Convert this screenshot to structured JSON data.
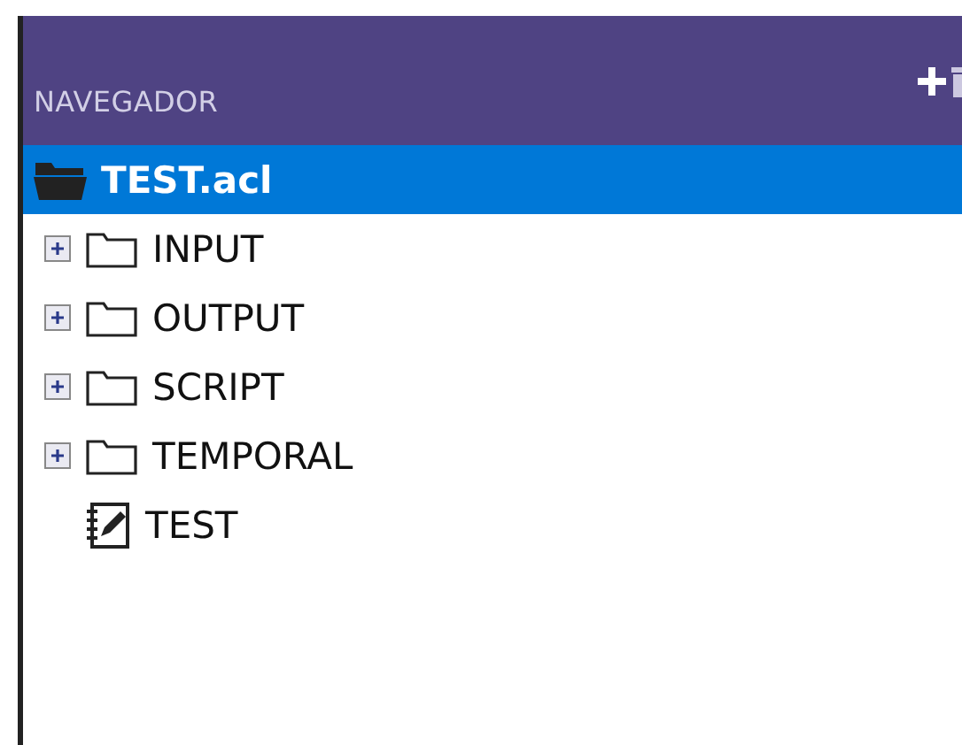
{
  "panel": {
    "title": "NAVEGADOR"
  },
  "tree": [
    {
      "label": "TEST.acl",
      "kind": "project",
      "selected": true,
      "expanded": true,
      "children": [
        {
          "label": "INPUT",
          "kind": "folder",
          "selected": false,
          "expanded": false
        },
        {
          "label": "OUTPUT",
          "kind": "folder",
          "selected": false,
          "expanded": false
        },
        {
          "label": "SCRIPT",
          "kind": "folder",
          "selected": false,
          "expanded": false
        },
        {
          "label": "TEMPORAL",
          "kind": "folder",
          "selected": false,
          "expanded": false
        },
        {
          "label": "TEST",
          "kind": "script",
          "selected": false
        }
      ]
    }
  ]
}
